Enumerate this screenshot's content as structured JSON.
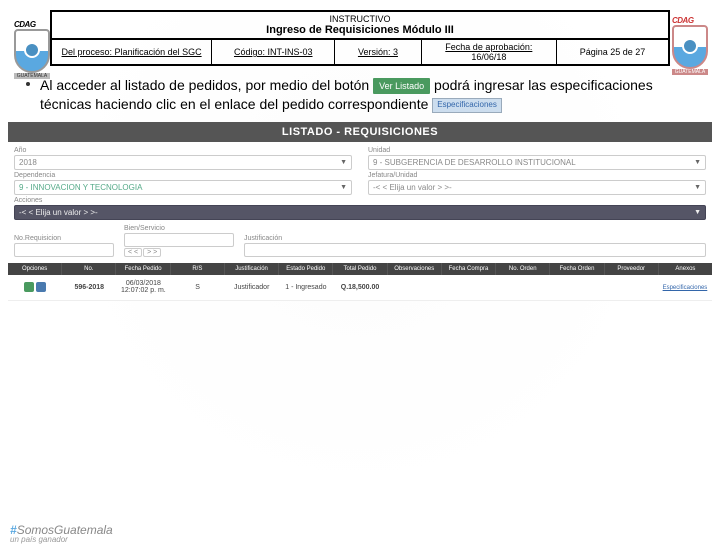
{
  "header": {
    "title": "INSTRUCTIVO",
    "subtitle": "Ingreso de Requisiciones Módulo III",
    "process": "Del proceso: Planificación del SGC",
    "code": "Código: INT-INS-03",
    "version": "Versión: 3",
    "approval_lbl": "Fecha de aprobación:",
    "approval_date": "16/06/18",
    "page": "Página 25 de 27"
  },
  "bullet": {
    "pre": "Al acceder al listado de pedidos, por medio del botón",
    "btn_ver": "Ver Listado",
    "mid": "podrá ingresar las especificaciones técnicas haciendo clic en el enlace del pedido correspondiente",
    "btn_spec": "Especificaciones"
  },
  "app": {
    "title": "LISTADO - REQUISICIONES",
    "labels": {
      "ano": "Año",
      "unidad": "Unidad",
      "dependencia": "Dependencia",
      "jefatura": "Jefatura/Unidad",
      "acciones": "Acciones",
      "noreq": "No.Requisicion",
      "bien": "Bien/Servicio",
      "just": "Justificación"
    },
    "selects": {
      "ano": "2018",
      "unidad": "9 - SUBGERENCIA DE DESARROLLO INSTITUCIONAL",
      "dependencia": "9 - INNOVACION Y TECNOLOGIA",
      "jefatura": "-< < Elija un valor > >-",
      "acciones": "-< < Elija un valor > >-"
    },
    "pager": {
      "prev": "< <",
      "next": "> >"
    },
    "thead": [
      "Opciones",
      "No.",
      "Fecha Pedido",
      "R/S",
      "Justificación",
      "Estado Pedido",
      "Total Pedido",
      "Observaciones",
      "Fecha Compra",
      "No. Orden",
      "Fecha Orden",
      "Proveedor",
      "Anexos"
    ],
    "row": {
      "no": "596-2018",
      "fecha": "06/03/2018 12:07:02 p. m.",
      "rs": "S",
      "just": "Justificador",
      "estado": "1 - Ingresado",
      "total": "Q.18,500.00",
      "anexo": "Especificaciones"
    }
  },
  "footer": {
    "hash": "#",
    "main": "SomosGuatemala",
    "sub": "un país ganador"
  },
  "org": {
    "abbr": "CDAG",
    "country": "GUATEMALA"
  }
}
